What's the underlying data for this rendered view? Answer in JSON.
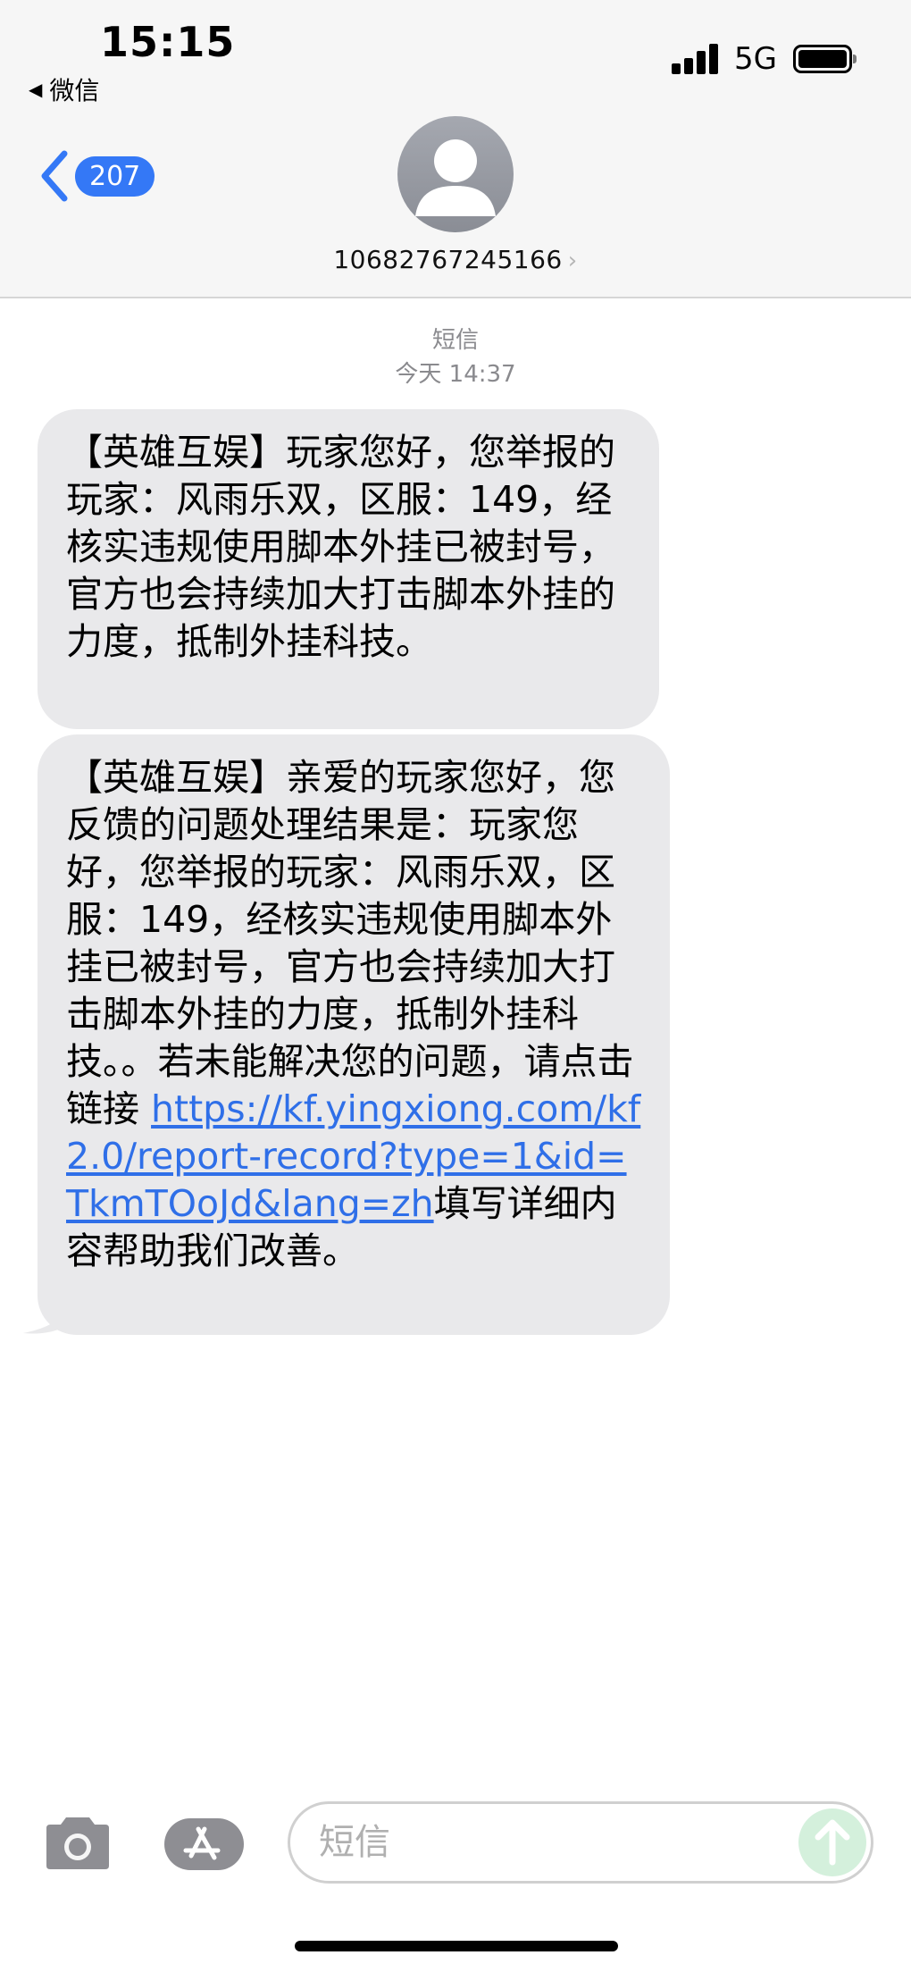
{
  "status_bar": {
    "time": "15:15",
    "back_app": "微信",
    "network": "5G",
    "icons": [
      "signal-icon",
      "battery-icon"
    ]
  },
  "header": {
    "unread_count": "207",
    "contact_number": "10682767245166",
    "icons": [
      "back-chevron-icon",
      "contact-avatar-icon",
      "chevron-right-icon"
    ]
  },
  "conversation": {
    "service": "短信",
    "timestamp": "今天 14:37",
    "messages": [
      {
        "text": "【英雄互娱】玩家您好，您举报的玩家：风雨乐双，区服：149，经核实违规使用脚本外挂已被封号，官方也会持续加大打击脚本外挂的力度，抵制外挂科技。"
      },
      {
        "text_before_link": "【英雄互娱】亲爱的玩家您好，您反馈的问题处理结果是：玩家您好，您举报的玩家：风雨乐双，区服：149，经核实违规使用脚本外挂已被封号，官方也会持续加大打击脚本外挂的力度，抵制外挂科技。。若未能解决您的问题，请点击链接 ",
        "link": "https://kf.yingxiong.com/kf2.0/report-record?type=1&id=TkmTOoJd&lang=zh",
        "text_after_link": "填写详细内容帮助我们改善。"
      }
    ]
  },
  "input_bar": {
    "placeholder": "短信",
    "icons": [
      "camera-icon",
      "app-store-icon",
      "send-arrow-icon"
    ]
  },
  "colors": {
    "accent": "#3478f6",
    "bubble_bg": "#e9e9eb",
    "link": "#2f6fe8",
    "send_button": "#d4f0dc"
  }
}
